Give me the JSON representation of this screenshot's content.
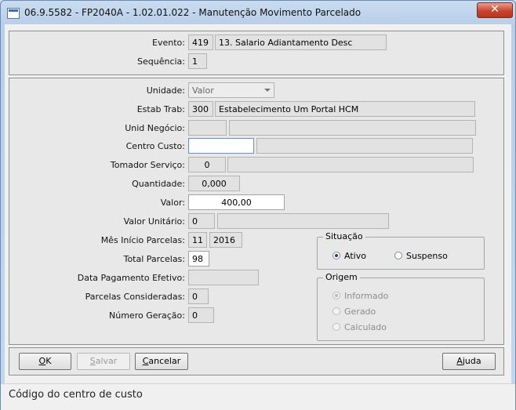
{
  "window": {
    "title": "06.9.5582 - FP2040A - 1.02.01.022 - Manutenção Movimento Parcelado",
    "close_glyph": "✕"
  },
  "header": {
    "evento_label": "Evento:",
    "evento_code": "419",
    "evento_desc": "13. Salario Adiantamento Desc",
    "sequencia_label": "Sequência:",
    "sequencia_value": "1"
  },
  "form": {
    "unidade_label": "Unidade:",
    "unidade_value": "Valor",
    "estab_label": "Estab Trab:",
    "estab_code": "300",
    "estab_desc": "Estabelecimento Um Portal HCM",
    "unid_negocio_label": "Unid Negócio:",
    "unid_negocio_code": "",
    "unid_negocio_desc": "",
    "centro_custo_label": "Centro Custo:",
    "centro_custo_code": "",
    "centro_custo_desc": "",
    "tomador_label": "Tomador Serviço:",
    "tomador_code": "0",
    "tomador_desc": "",
    "quantidade_label": "Quantidade:",
    "quantidade_value": "0,000",
    "valor_label": "Valor:",
    "valor_value": "400,00",
    "valor_unitario_label": "Valor Unitário:",
    "valor_unitario_value": "0",
    "valor_unitario_extra": "",
    "mes_inicio_label": "Mês Início Parcelas:",
    "mes_inicio_month": "11",
    "mes_inicio_year": "2016",
    "total_parcelas_label": "Total Parcelas:",
    "total_parcelas_value": "98",
    "data_pagamento_label": "Data Pagamento Efetivo:",
    "data_pagamento_value": "",
    "parcelas_consideradas_label": "Parcelas Consideradas:",
    "parcelas_consideradas_value": "0",
    "numero_geracao_label": "Número Geração:",
    "numero_geracao_value": "0"
  },
  "situacao": {
    "title": "Situação",
    "options": [
      {
        "label": "Ativo",
        "selected": true
      },
      {
        "label": "Suspenso",
        "selected": false
      }
    ]
  },
  "origem": {
    "title": "Origem",
    "options": [
      {
        "label": "Informado",
        "selected": true
      },
      {
        "label": "Gerado",
        "selected": false
      },
      {
        "label": "Calculado",
        "selected": false
      }
    ]
  },
  "buttons": {
    "ok_key": "O",
    "ok_rest": "K",
    "salvar_key": "S",
    "salvar_rest": "alvar",
    "cancelar_key": "C",
    "cancelar_rest": "ancelar",
    "ajuda_key": "A",
    "ajuda_rest": "juda"
  },
  "status": {
    "text": "Código do centro de custo"
  }
}
